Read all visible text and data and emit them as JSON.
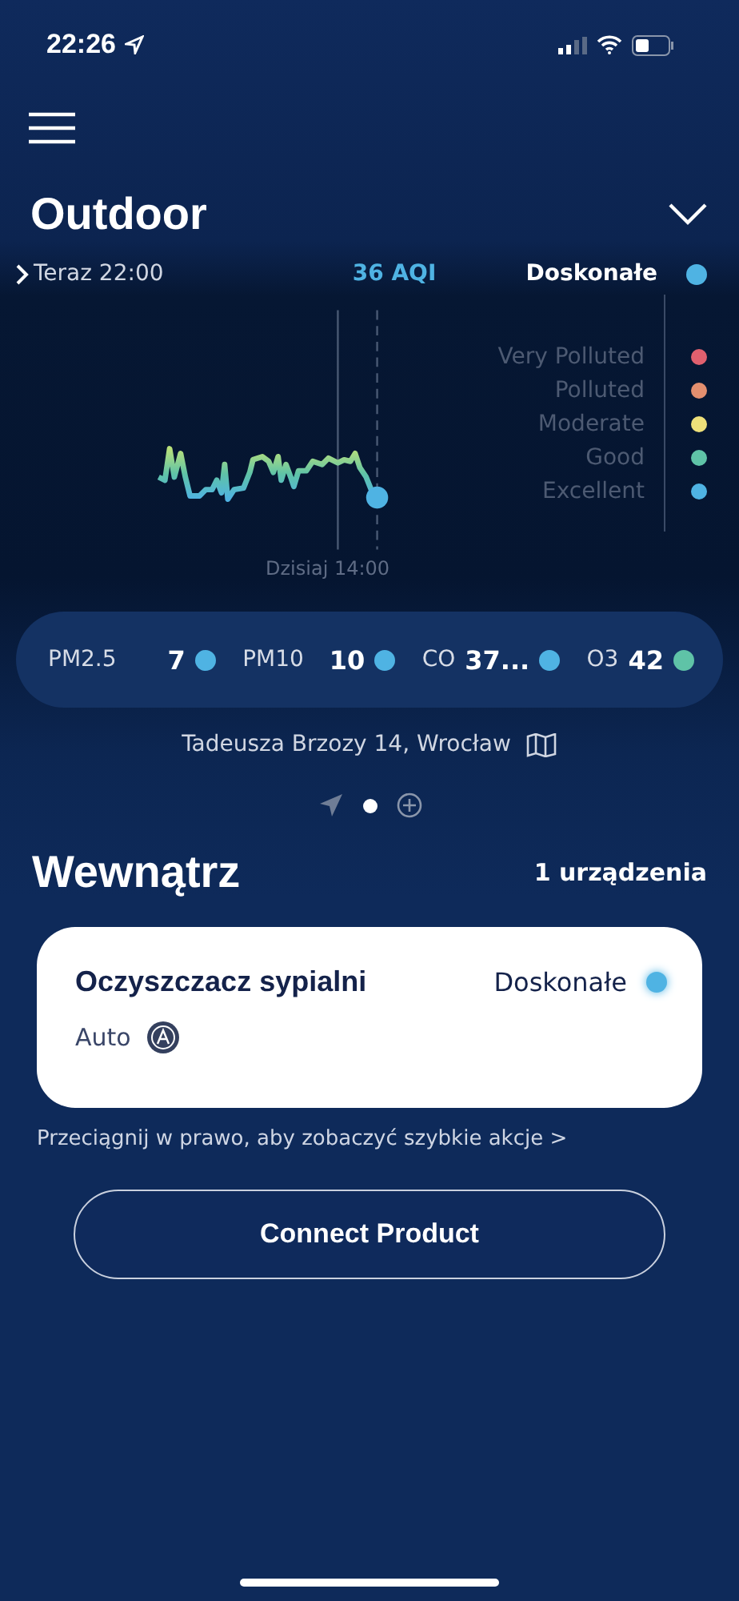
{
  "status_bar": {
    "time": "22:26"
  },
  "outdoor": {
    "title": "Outdoor",
    "time": "Teraz 22:00",
    "aqi": "36 AQI",
    "rating": {
      "label": "Doskonałe",
      "color": "#4fb3e3"
    },
    "chart_time": "Dzisiaj 14:00",
    "legend": [
      {
        "label": "Very Polluted",
        "color": "#e0606e"
      },
      {
        "label": "Polluted",
        "color": "#e38f6f"
      },
      {
        "label": "Moderate",
        "color": "#eee07a"
      },
      {
        "label": "Good",
        "color": "#5fc3a7"
      },
      {
        "label": "Excellent",
        "color": "#4fb3e3"
      }
    ],
    "pollutants": [
      {
        "name": "PM2.5",
        "value": "7",
        "color": "#4fb3e3"
      },
      {
        "name": "PM10",
        "value": "10",
        "color": "#4fb3e3"
      },
      {
        "name": "CO",
        "value": "37...",
        "color": "#4fb3e3"
      },
      {
        "name": "O3",
        "value": "42",
        "color": "#5fc3a7"
      }
    ],
    "address": "Tadeusza Brzozy 14, Wrocław",
    "pages": [
      {
        "kind": "location",
        "selected": false
      },
      {
        "kind": "dot",
        "selected": true
      },
      {
        "kind": "add",
        "selected": false
      }
    ]
  },
  "indoor": {
    "title": "Wewnątrz",
    "count": "1 urządzenia",
    "devices": [
      {
        "name": "Oczyszczacz sypialni",
        "rating": "Doskonałe",
        "color": "#4fb3e3",
        "mode": "Auto"
      }
    ],
    "hint": "Przeciągnij w prawo, aby zobaczyć szybkie akcje >",
    "button": "Connect Product"
  }
}
